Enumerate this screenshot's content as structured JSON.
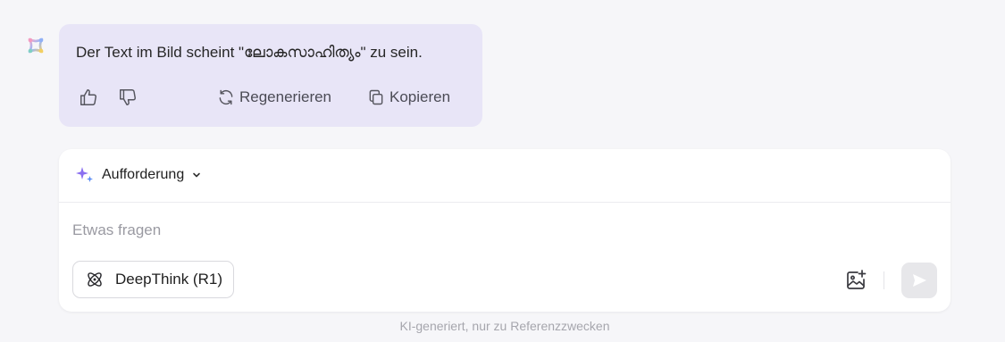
{
  "message": {
    "text": "Der Text im Bild scheint \"ലോകസാഹിത്യം\" zu sein.",
    "actions": {
      "thumbs_up_icon": "thumbs-up-icon",
      "thumbs_down_icon": "thumbs-down-icon",
      "regenerate_label": "Regenerieren",
      "copy_label": "Kopieren"
    }
  },
  "composer": {
    "prompt_selector_label": "Aufforderung",
    "input_placeholder": "Etwas fragen",
    "input_value": "",
    "deepthink_label": "DeepThink (R1)"
  },
  "footer": {
    "disclaimer": "KI-generiert, nur zu Referenzzwecken"
  },
  "colors": {
    "page_background": "#f6f6f9",
    "bubble_background": "#e8e5f7",
    "sparkle_purple": "#8a6ff0",
    "sparkle_blue": "#5b8cf5",
    "send_button_disabled": "#e7e7ea"
  }
}
